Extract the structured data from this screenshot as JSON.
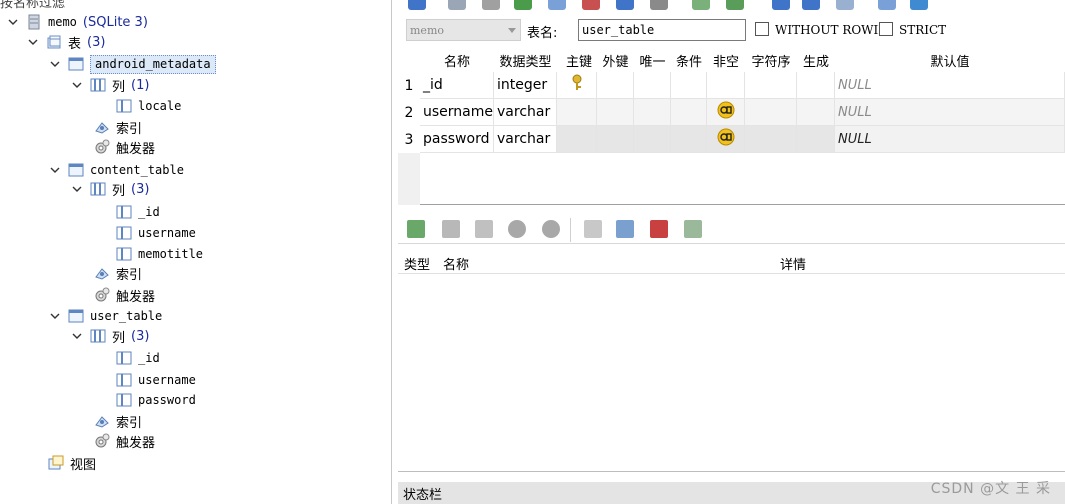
{
  "filter_label": "按名称过滤",
  "tree": {
    "database": {
      "name": "memo",
      "type": "(SQLite 3)"
    },
    "tables_node": {
      "label": "表",
      "count": "(3)"
    },
    "tables": [
      {
        "name": "android_metadata",
        "columns_label": "列",
        "columns_count": "(1)",
        "columns": [
          "locale"
        ],
        "indexes_label": "索引",
        "triggers_label": "触发器"
      },
      {
        "name": "content_table",
        "columns_label": "列",
        "columns_count": "(3)",
        "columns": [
          "_id",
          "username",
          "memotitle"
        ],
        "indexes_label": "索引",
        "triggers_label": "触发器"
      },
      {
        "name": "user_table",
        "columns_label": "列",
        "columns_count": "(3)",
        "columns": [
          "_id",
          "username",
          "password"
        ],
        "indexes_label": "索引",
        "triggers_label": "触发器"
      }
    ],
    "views_label": "视图"
  },
  "editor": {
    "db_select_value": "memo",
    "table_name_label": "表名:",
    "table_name_value": "user_table",
    "without_rowid_label": "WITHOUT ROWID",
    "strict_label": "STRICT"
  },
  "grid": {
    "headers": [
      "名称",
      "数据类型",
      "主键",
      "外键",
      "唯一",
      "条件",
      "非空",
      "字符序",
      "生成",
      "默认值"
    ],
    "rows": [
      {
        "num": "1",
        "name": "_id",
        "type": "integer",
        "pk": true,
        "notnull": false,
        "default": "NULL"
      },
      {
        "num": "2",
        "name": "username",
        "type": "varchar",
        "pk": false,
        "notnull": true,
        "default": "NULL"
      },
      {
        "num": "3",
        "name": "password",
        "type": "varchar",
        "pk": false,
        "notnull": true,
        "default": "NULL"
      }
    ]
  },
  "index_list": {
    "headers": [
      "类型",
      "名称",
      "详情"
    ]
  },
  "status_bar": {
    "label": "状态栏"
  },
  "watermark": "CSDN @文 王 采",
  "colors": {
    "selection": "#dce9f8",
    "accent": "#1a2a9c",
    "status": "#e4e4e4"
  }
}
